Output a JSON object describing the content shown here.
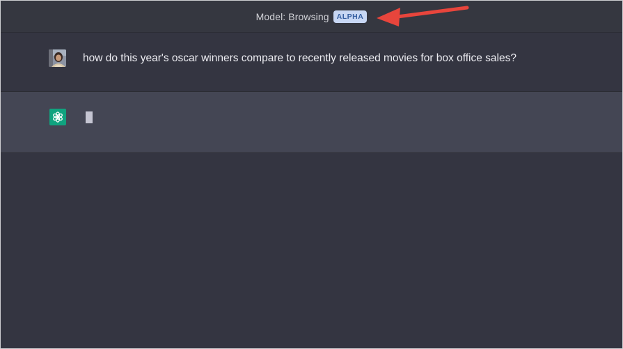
{
  "header": {
    "model_label": "Model: Browsing",
    "model_badge": "ALPHA"
  },
  "conversation": {
    "user_message": "how do this year's oscar winners compare to recently released movies for box office sales?",
    "assistant_state": "typing-cursor"
  },
  "icons": {
    "user_avatar": "avatar-photo",
    "assistant_avatar": "openai-logo-icon",
    "annotation": "red-arrow-icon"
  },
  "colors": {
    "background": "#343541",
    "assistant_row": "#444654",
    "badge_bg": "#c8d7f4",
    "badge_text": "#355ea0",
    "openai_green": "#10a37f",
    "arrow_red": "#e8453c"
  }
}
